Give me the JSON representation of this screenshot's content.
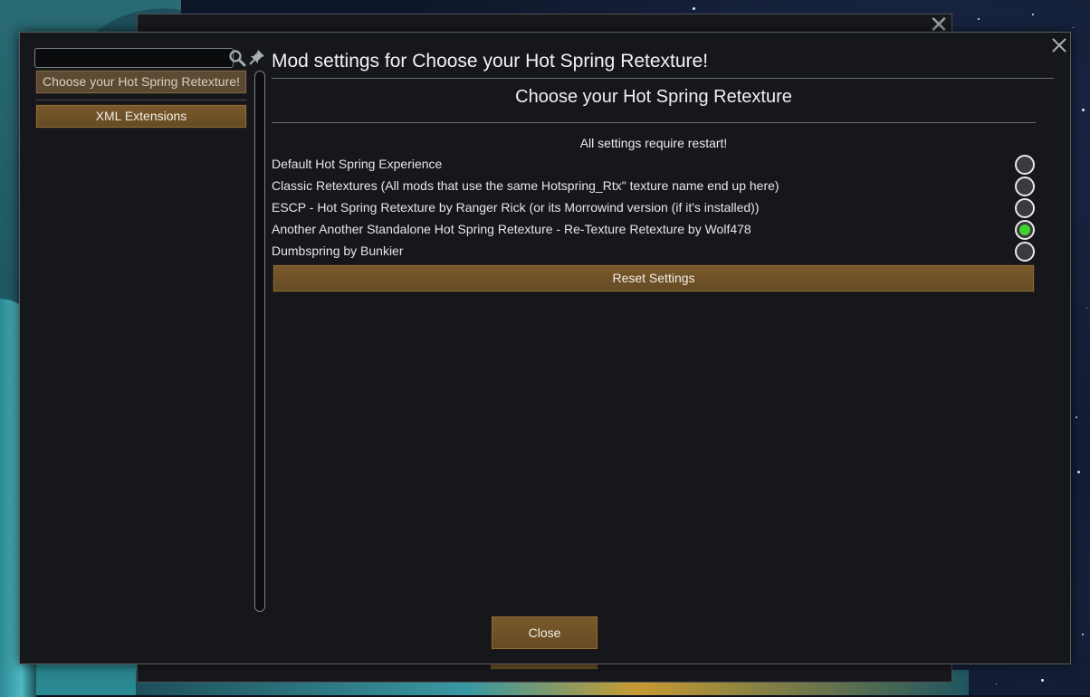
{
  "dialog": {
    "title": "Mod settings for Choose your Hot Spring Retexture!",
    "close_icon": "close-icon"
  },
  "sidebar": {
    "search": {
      "value": "",
      "placeholder": ""
    },
    "search_icon": "search-icon",
    "pin_icon": "pin-icon",
    "mods": [
      {
        "label": "Choose your Hot Spring Retexture!",
        "selected": true
      },
      {
        "label": "XML Extensions",
        "selected": false
      }
    ]
  },
  "settings": {
    "heading": "Choose your Hot Spring Retexture",
    "note": "All settings require restart!",
    "options": [
      {
        "label": "Default Hot Spring Experience",
        "checked": false
      },
      {
        "label": "Classic Retextures (All mods that use the same Hotspring_Rtx\" texture name end up here)",
        "checked": false
      },
      {
        "label": "ESCP - Hot Spring Retexture by Ranger Rick (or its Morrowind version (if it's installed))",
        "checked": false
      },
      {
        "label": "Another Another Standalone Hot Spring Retexture - Re-Texture Retexture by Wolf478",
        "checked": true
      },
      {
        "label": "Dumbspring by Bunkier",
        "checked": false
      }
    ],
    "reset_label": "Reset Settings"
  },
  "footer": {
    "close_label": "Close"
  },
  "colors": {
    "panel": "#15171b",
    "button": "#6f522a",
    "radio_checked": "#3fd32d"
  }
}
